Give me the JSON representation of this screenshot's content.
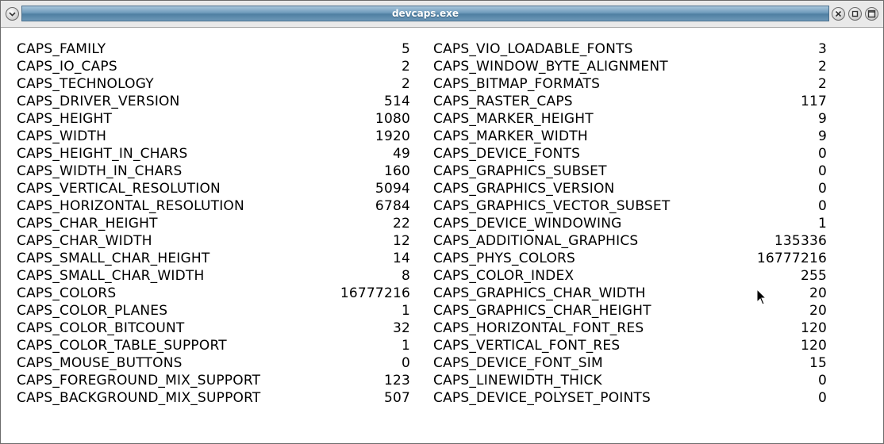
{
  "window": {
    "title": "devcaps.exe"
  },
  "icons": {
    "menu": "chevron-down-icon",
    "close": "close-icon",
    "minimize": "minimize-icon",
    "maximize": "maximize-icon",
    "cursor": "mouse-pointer-icon"
  },
  "colors": {
    "title_bar": "#6f9bbb",
    "background": "#ffffff",
    "text": "#000000"
  },
  "caps_left": [
    {
      "name": "CAPS_FAMILY",
      "value": "5"
    },
    {
      "name": "CAPS_IO_CAPS",
      "value": "2"
    },
    {
      "name": "CAPS_TECHNOLOGY",
      "value": "2"
    },
    {
      "name": "CAPS_DRIVER_VERSION",
      "value": "514"
    },
    {
      "name": "CAPS_HEIGHT",
      "value": "1080"
    },
    {
      "name": "CAPS_WIDTH",
      "value": "1920"
    },
    {
      "name": "CAPS_HEIGHT_IN_CHARS",
      "value": "49"
    },
    {
      "name": "CAPS_WIDTH_IN_CHARS",
      "value": "160"
    },
    {
      "name": "CAPS_VERTICAL_RESOLUTION",
      "value": "5094"
    },
    {
      "name": "CAPS_HORIZONTAL_RESOLUTION",
      "value": "6784"
    },
    {
      "name": "CAPS_CHAR_HEIGHT",
      "value": "22"
    },
    {
      "name": "CAPS_CHAR_WIDTH",
      "value": "12"
    },
    {
      "name": "CAPS_SMALL_CHAR_HEIGHT",
      "value": "14"
    },
    {
      "name": "CAPS_SMALL_CHAR_WIDTH",
      "value": "8"
    },
    {
      "name": "CAPS_COLORS",
      "value": "16777216"
    },
    {
      "name": "CAPS_COLOR_PLANES",
      "value": "1"
    },
    {
      "name": "CAPS_COLOR_BITCOUNT",
      "value": "32"
    },
    {
      "name": "CAPS_COLOR_TABLE_SUPPORT",
      "value": "1"
    },
    {
      "name": "CAPS_MOUSE_BUTTONS",
      "value": "0"
    },
    {
      "name": "CAPS_FOREGROUND_MIX_SUPPORT",
      "value": "123"
    },
    {
      "name": "CAPS_BACKGROUND_MIX_SUPPORT",
      "value": "507"
    }
  ],
  "caps_right": [
    {
      "name": "CAPS_VIO_LOADABLE_FONTS",
      "value": "3"
    },
    {
      "name": "CAPS_WINDOW_BYTE_ALIGNMENT",
      "value": "2"
    },
    {
      "name": "CAPS_BITMAP_FORMATS",
      "value": "2"
    },
    {
      "name": "CAPS_RASTER_CAPS",
      "value": "117"
    },
    {
      "name": "CAPS_MARKER_HEIGHT",
      "value": "9"
    },
    {
      "name": "CAPS_MARKER_WIDTH",
      "value": "9"
    },
    {
      "name": "CAPS_DEVICE_FONTS",
      "value": "0"
    },
    {
      "name": "CAPS_GRAPHICS_SUBSET",
      "value": "0"
    },
    {
      "name": "CAPS_GRAPHICS_VERSION",
      "value": "0"
    },
    {
      "name": "CAPS_GRAPHICS_VECTOR_SUBSET",
      "value": "0"
    },
    {
      "name": "CAPS_DEVICE_WINDOWING",
      "value": "1"
    },
    {
      "name": "CAPS_ADDITIONAL_GRAPHICS",
      "value": "135336"
    },
    {
      "name": "CAPS_PHYS_COLORS",
      "value": "16777216"
    },
    {
      "name": "CAPS_COLOR_INDEX",
      "value": "255"
    },
    {
      "name": "CAPS_GRAPHICS_CHAR_WIDTH",
      "value": "20"
    },
    {
      "name": "CAPS_GRAPHICS_CHAR_HEIGHT",
      "value": "20"
    },
    {
      "name": "CAPS_HORIZONTAL_FONT_RES",
      "value": "120"
    },
    {
      "name": "CAPS_VERTICAL_FONT_RES",
      "value": "120"
    },
    {
      "name": "CAPS_DEVICE_FONT_SIM",
      "value": "15"
    },
    {
      "name": "CAPS_LINEWIDTH_THICK",
      "value": "0"
    },
    {
      "name": "CAPS_DEVICE_POLYSET_POINTS",
      "value": "0"
    }
  ]
}
